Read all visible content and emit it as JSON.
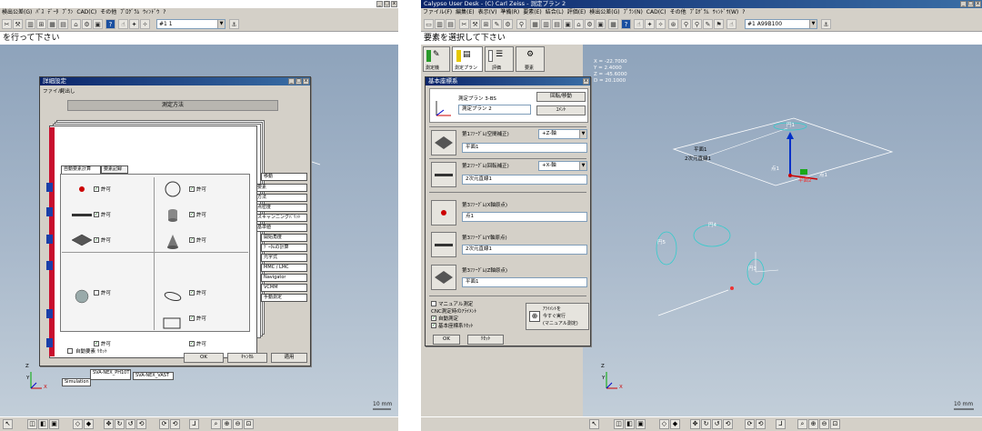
{
  "left": {
    "menu": [
      "ﾊﾟｽ",
      "ﾃﾞｰﾀ",
      "ﾌﾟﾗﾝ",
      "CAD(C)",
      "その他",
      "ﾌﾟﾛｸﾞﾗﾑ",
      "ｳｨﾝﾄﾞｳ",
      "?"
    ],
    "menu_first": "検出公差(G)",
    "combo_value": "#1  1",
    "message": "を行って下さい",
    "scale": "10 mm",
    "axes": {
      "z": "Z",
      "y": "Y",
      "x": "X"
    },
    "dialog": {
      "title": "詳細設定",
      "menu": [
        "ファイル",
        "見出し"
      ],
      "header": "測定方法",
      "tabs": [
        "自動要素計算",
        "要素記録"
      ],
      "check_label": "許可",
      "auto_label": "自動要素 ﾘｾｯﾄ",
      "right_tabs": [
        "移動",
        "要素",
        "方法",
        "点密度",
        "スキャンニングﾊﾟﾘｯﾄ",
        "基準値",
        "開始角度",
        "ﾃﾞｰﾀﾑの計算",
        "元字式",
        "MMC / LMC",
        "Navigator",
        "VCMM",
        "手動測定"
      ],
      "bottom_tabs": [
        "SVA-NEX_PH10T",
        "SVA-NEX_VAST",
        "Simulation"
      ],
      "buttons": {
        "ok": "OK",
        "cancel": "ｷｬﾝｾﾙ",
        "apply": "適用"
      }
    }
  },
  "right": {
    "title": "Calypso User Desk - (C) Carl Zeiss - 測定プラン 2",
    "menu": [
      "ファイル(F)",
      "編集(E)",
      "表示(V)",
      "準備(R)",
      "要素(E)",
      "結合(L)",
      "評価(E)",
      "検出公差(G)",
      "ﾌﾟﾗﾝ(N)",
      "CAD(C)",
      "その他",
      "ﾌﾟﾛｸﾞﾗﾑ",
      "ｳｨﾝﾄﾞｳ(W)",
      "?"
    ],
    "combo_value": "#1    A99B100",
    "message": "要素を選択して下さい",
    "scale": "10 mm",
    "axes": {
      "z": "Z",
      "y": "Y",
      "x": "X"
    },
    "panel_tabs": [
      "測定機",
      "測定プラン",
      "評価",
      "要素"
    ],
    "coords": {
      "x": "X =  -22.7000",
      "y": "Y =   2.4000",
      "z": "Z =  -45.6000",
      "d": "D =  20.1000"
    },
    "labels3d": [
      "円1",
      "平面1",
      "2次元直線1",
      "点1",
      "円5",
      "円4",
      "円3",
      "点1",
      "平面2"
    ],
    "dialog": {
      "title": "基本座標系",
      "plan_label": "測定プラン 3-BS",
      "plan_value": "測定プラン 2",
      "btn_rotate": "回転/移動",
      "btn_comment": "ｺﾒﾝﾄ",
      "s1_label": "第1ﾌｧｰｸﾞﾑ(空間補正)",
      "s1_axis": "+Z-軸",
      "s1_value": "平面1",
      "s2_label": "第2ﾌｧｰｸﾞﾑ(回転補正)",
      "s2_axis": "+X-軸",
      "s2_value": "2次元直線1",
      "s3_label": "第3ﾌｧｰｸﾞﾑ(X軸原点)",
      "s3_value": "点1",
      "s4_label": "第3ﾌｧｰｸﾞﾑ(Y軸原点)",
      "s4_value": "2次元直線1",
      "s5_label": "第3ﾌｧｰｸﾞﾑ(Z軸原点)",
      "s5_value": "平面1",
      "opts": [
        "マニュアル測定",
        "CNC測定時のｱﾗｲﾒﾝﾄ",
        "自動測定",
        "基本座標系ﾘｾｯﾄ"
      ],
      "align_text": [
        "ｱﾗｲﾒﾝﾄを",
        "今すぐ実行",
        "(マニュアル測定)"
      ],
      "ok": "OK",
      "reset": "ﾘｾｯﾄ"
    }
  }
}
